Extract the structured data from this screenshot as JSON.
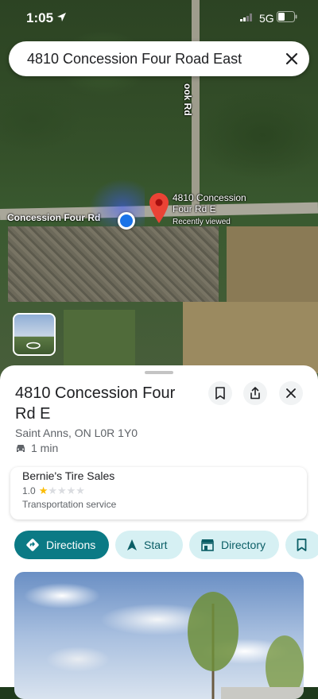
{
  "status_bar": {
    "time": "1:05",
    "network": "5G"
  },
  "search": {
    "query": "4810 Concession Four Road East"
  },
  "map": {
    "road_label": "Concession Four Rd",
    "side_road_label": "ook Rd",
    "pin_label_line1": "4810 Concession",
    "pin_label_line2": "Four Rd E",
    "pin_sublabel": "Recently viewed"
  },
  "place": {
    "title": "4810 Concession Four Rd E",
    "address": "Saint Anns, ON L0R 1Y0",
    "drive_time": "1 min"
  },
  "nearby": {
    "name": "Bernie's Tire Sales",
    "rating": "1.0",
    "stars": "★☆☆☆☆",
    "category": "Transportation service"
  },
  "actions": {
    "directions": "Directions",
    "start": "Start",
    "directory": "Directory"
  }
}
